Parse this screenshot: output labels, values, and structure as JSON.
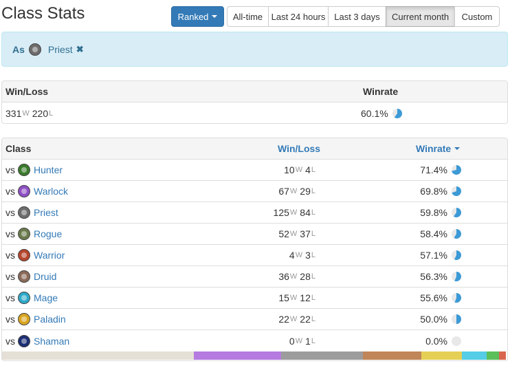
{
  "title": "Class Stats",
  "toolbar": {
    "ranked_label": "Ranked",
    "periods": [
      "All-time",
      "Last 24 hours",
      "Last 3 days",
      "Current month",
      "Custom"
    ],
    "active_period": "Current month"
  },
  "filter": {
    "as_label": "As",
    "class_name": "Priest",
    "remove_glyph": "✖",
    "icon": "priest-icon"
  },
  "summary": {
    "headers": {
      "winloss": "Win/Loss",
      "winrate": "Winrate"
    },
    "wins": "331",
    "wins_suffix": "W",
    "losses": "220",
    "losses_suffix": "L",
    "winrate": "60.1%",
    "winrate_fraction": 0.601
  },
  "classes": {
    "headers": {
      "class": "Class",
      "winloss": "Win/Loss",
      "winrate": "Winrate"
    },
    "vs_label": "vs",
    "win_suffix": "W",
    "loss_suffix": "L",
    "rows": [
      {
        "name": "Hunter",
        "icon": "hunter-icon",
        "color": "#3a7a2c",
        "wins": "10",
        "losses": "4",
        "winrate": "71.4%",
        "fraction": 0.714
      },
      {
        "name": "Warlock",
        "icon": "warlock-icon",
        "color": "#8e4fc4",
        "wins": "67",
        "losses": "29",
        "winrate": "69.8%",
        "fraction": 0.698
      },
      {
        "name": "Priest",
        "icon": "priest-icon",
        "color": "#6d6d6d",
        "wins": "125",
        "losses": "84",
        "winrate": "59.8%",
        "fraction": 0.598
      },
      {
        "name": "Rogue",
        "icon": "rogue-icon",
        "color": "#6b7a4c",
        "wins": "52",
        "losses": "37",
        "winrate": "58.4%",
        "fraction": 0.584
      },
      {
        "name": "Warrior",
        "icon": "warrior-icon",
        "color": "#b5452c",
        "wins": "4",
        "losses": "3",
        "winrate": "57.1%",
        "fraction": 0.571
      },
      {
        "name": "Druid",
        "icon": "druid-icon",
        "color": "#8a6a5a",
        "wins": "36",
        "losses": "28",
        "winrate": "56.3%",
        "fraction": 0.563
      },
      {
        "name": "Mage",
        "icon": "mage-icon",
        "color": "#2fa9c9",
        "wins": "15",
        "losses": "12",
        "winrate": "55.6%",
        "fraction": 0.556
      },
      {
        "name": "Paladin",
        "icon": "paladin-icon",
        "color": "#d9a520",
        "wins": "22",
        "losses": "22",
        "winrate": "50.0%",
        "fraction": 0.5
      },
      {
        "name": "Shaman",
        "icon": "shaman-icon",
        "color": "#1c2e73",
        "wins": "0",
        "losses": "1",
        "winrate": "0.0%",
        "fraction": 0.0
      }
    ]
  },
  "colors": {
    "accent": "#337ab7",
    "pie": "#3c9ad6",
    "pie_empty": "#e8e8e8",
    "alert_bg": "#d9edf7",
    "alert_text": "#31708f"
  },
  "class_share_bar": [
    {
      "class": "Priest",
      "color": "#e5e0d6",
      "share": 0.379
    },
    {
      "class": "Warlock",
      "color": "#b57be0",
      "share": 0.174
    },
    {
      "class": "Rogue",
      "color": "#9c9c9c",
      "share": 0.161
    },
    {
      "class": "Druid",
      "color": "#c08558",
      "share": 0.116
    },
    {
      "class": "Paladin",
      "color": "#e5cf55",
      "share": 0.08
    },
    {
      "class": "Mage",
      "color": "#55cde6",
      "share": 0.049
    },
    {
      "class": "Hunter",
      "color": "#5cbf5a",
      "share": 0.025
    },
    {
      "class": "Warrior",
      "color": "#d9654f",
      "share": 0.013
    }
  ]
}
